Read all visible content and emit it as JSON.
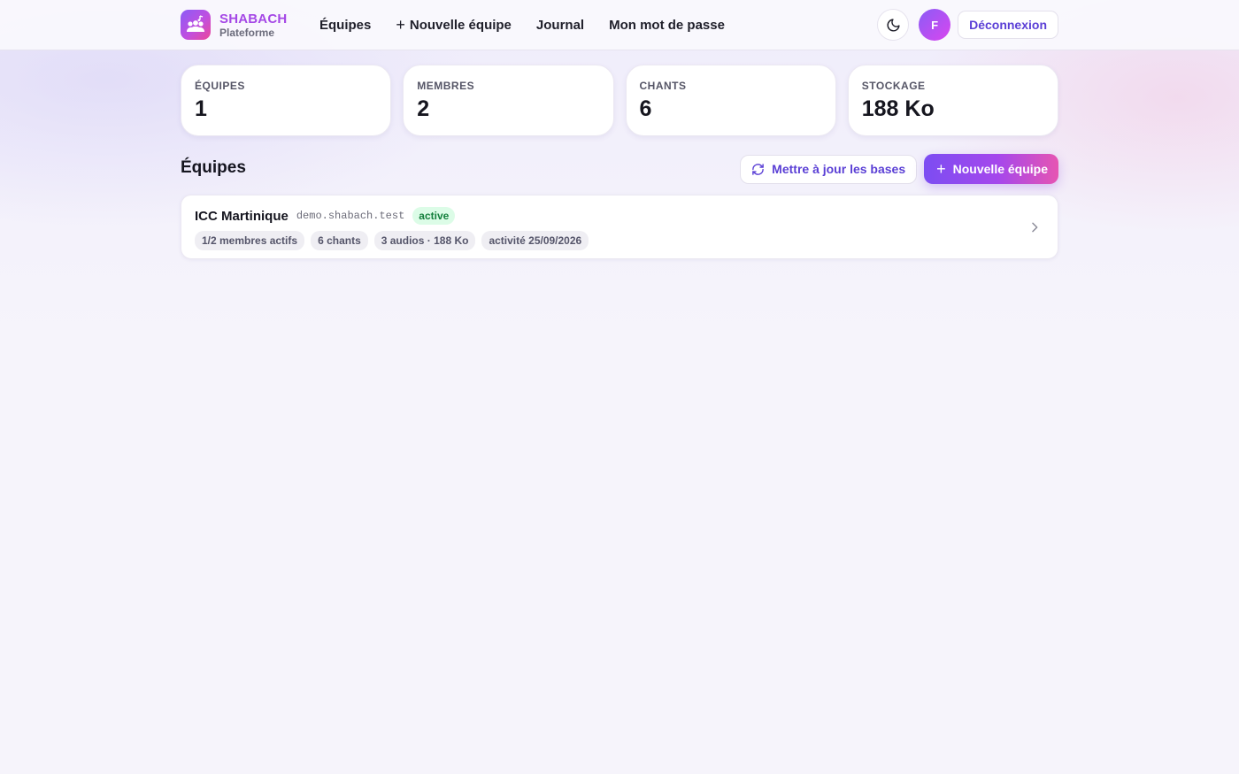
{
  "header": {
    "brand_name": "SHABACH",
    "brand_subtitle": "Plateforme",
    "nav": [
      {
        "label": "Équipes"
      },
      {
        "label": "Nouvelle équipe"
      },
      {
        "label": "Journal"
      },
      {
        "label": "Mon mot de passe"
      }
    ],
    "avatar_initial": "F",
    "logout_label": "Déconnexion",
    "icons": {
      "theme": "moon-icon",
      "add": "plus-icon",
      "logo": "music-group-icon"
    }
  },
  "stats": [
    {
      "label": "ÉQUIPES",
      "value": "1"
    },
    {
      "label": "MEMBRES",
      "value": "2"
    },
    {
      "label": "CHANTS",
      "value": "6"
    },
    {
      "label": "STOCKAGE",
      "value": "188 Ko"
    }
  ],
  "teams_section": {
    "title": "Équipes",
    "update_bases_label": "Mettre à jour les bases",
    "new_team_label": "Nouvelle équipe"
  },
  "teams": [
    {
      "name": "ICC Martinique",
      "domain": "demo.shabach.test",
      "status": "active",
      "chips": [
        "1/2 membres actifs",
        "6 chants",
        "3 audios · 188 Ko",
        "activité 25/09/2026"
      ]
    }
  ],
  "colors": {
    "accent": "#5b3fd6",
    "brand_gradient_start": "#8b5cf6",
    "brand_gradient_end": "#ec4899",
    "status_active_text": "#15803d",
    "status_active_bg": "#dcfce7",
    "page_bg": "#f6f4fb"
  }
}
